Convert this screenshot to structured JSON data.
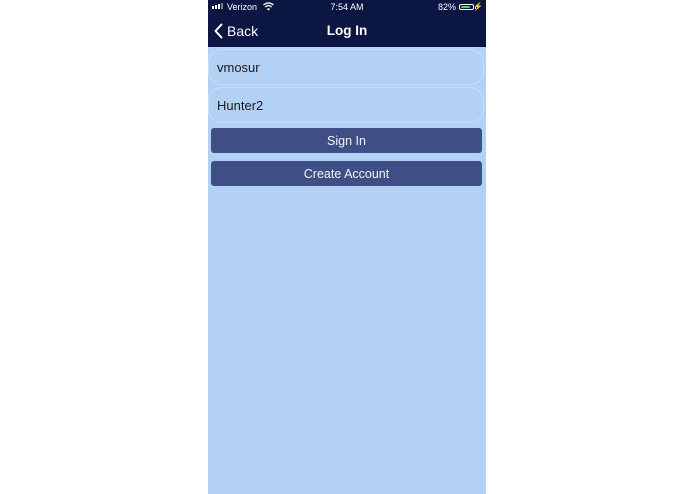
{
  "status_bar": {
    "carrier": "Verizon",
    "time": "7:54 AM",
    "battery_percent": "82%",
    "battery_level": 0.82,
    "wifi_icon": "wifi-icon",
    "charging_icon": "bolt-icon"
  },
  "nav": {
    "back_label": "Back",
    "title": "Log In"
  },
  "form": {
    "username_value": "vmosur",
    "password_value": "Hunter2",
    "sign_in_label": "Sign In",
    "create_account_label": "Create Account"
  },
  "colors": {
    "header_background": "#0c1642",
    "page_background": "#b3d1f5",
    "button_background": "#3f4f85",
    "battery_green": "#4cd964"
  }
}
